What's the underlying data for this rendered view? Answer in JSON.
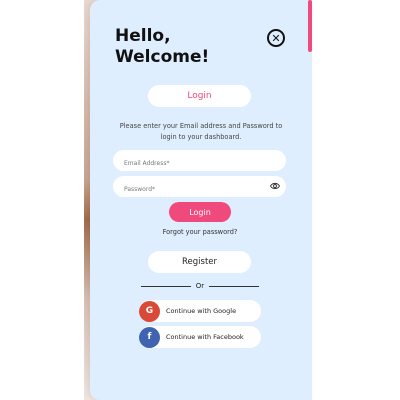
{
  "header": {
    "greeting": "Hello,\nWelcome!"
  },
  "tabs": {
    "login_label": "Login"
  },
  "instructions": "Please enter your Email address and Password to login to your dashboard.",
  "form": {
    "email_placeholder": "Email Address*",
    "password_placeholder": "Password*",
    "login_button": "Login",
    "forgot_password": "Forgot your password?"
  },
  "register_button": "Register",
  "divider_text": "Or",
  "social": {
    "google_label": "Continue with Google",
    "google_icon": "G",
    "facebook_label": "Continue with Facebook",
    "facebook_icon": "f"
  },
  "colors": {
    "accent": "#f0497c",
    "panel_bg": "#deeefe",
    "google": "#d84a37",
    "facebook": "#3f63b0"
  }
}
